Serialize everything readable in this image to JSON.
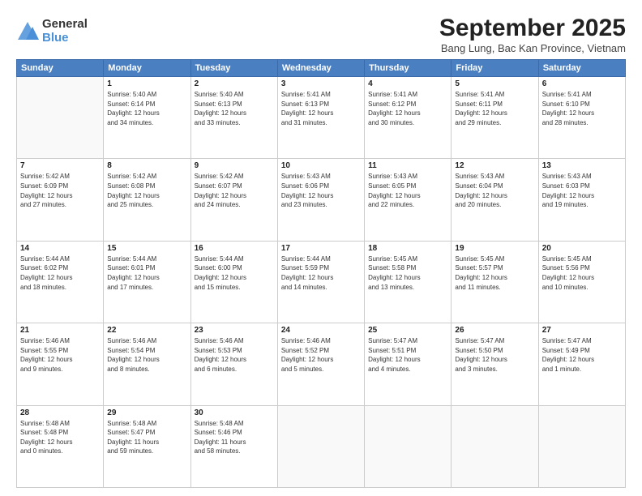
{
  "logo": {
    "general": "General",
    "blue": "Blue"
  },
  "title": "September 2025",
  "subtitle": "Bang Lung, Bac Kan Province, Vietnam",
  "headers": [
    "Sunday",
    "Monday",
    "Tuesday",
    "Wednesday",
    "Thursday",
    "Friday",
    "Saturday"
  ],
  "weeks": [
    [
      {
        "day": "",
        "info": ""
      },
      {
        "day": "1",
        "info": "Sunrise: 5:40 AM\nSunset: 6:14 PM\nDaylight: 12 hours\nand 34 minutes."
      },
      {
        "day": "2",
        "info": "Sunrise: 5:40 AM\nSunset: 6:13 PM\nDaylight: 12 hours\nand 33 minutes."
      },
      {
        "day": "3",
        "info": "Sunrise: 5:41 AM\nSunset: 6:13 PM\nDaylight: 12 hours\nand 31 minutes."
      },
      {
        "day": "4",
        "info": "Sunrise: 5:41 AM\nSunset: 6:12 PM\nDaylight: 12 hours\nand 30 minutes."
      },
      {
        "day": "5",
        "info": "Sunrise: 5:41 AM\nSunset: 6:11 PM\nDaylight: 12 hours\nand 29 minutes."
      },
      {
        "day": "6",
        "info": "Sunrise: 5:41 AM\nSunset: 6:10 PM\nDaylight: 12 hours\nand 28 minutes."
      }
    ],
    [
      {
        "day": "7",
        "info": "Sunrise: 5:42 AM\nSunset: 6:09 PM\nDaylight: 12 hours\nand 27 minutes."
      },
      {
        "day": "8",
        "info": "Sunrise: 5:42 AM\nSunset: 6:08 PM\nDaylight: 12 hours\nand 25 minutes."
      },
      {
        "day": "9",
        "info": "Sunrise: 5:42 AM\nSunset: 6:07 PM\nDaylight: 12 hours\nand 24 minutes."
      },
      {
        "day": "10",
        "info": "Sunrise: 5:43 AM\nSunset: 6:06 PM\nDaylight: 12 hours\nand 23 minutes."
      },
      {
        "day": "11",
        "info": "Sunrise: 5:43 AM\nSunset: 6:05 PM\nDaylight: 12 hours\nand 22 minutes."
      },
      {
        "day": "12",
        "info": "Sunrise: 5:43 AM\nSunset: 6:04 PM\nDaylight: 12 hours\nand 20 minutes."
      },
      {
        "day": "13",
        "info": "Sunrise: 5:43 AM\nSunset: 6:03 PM\nDaylight: 12 hours\nand 19 minutes."
      }
    ],
    [
      {
        "day": "14",
        "info": "Sunrise: 5:44 AM\nSunset: 6:02 PM\nDaylight: 12 hours\nand 18 minutes."
      },
      {
        "day": "15",
        "info": "Sunrise: 5:44 AM\nSunset: 6:01 PM\nDaylight: 12 hours\nand 17 minutes."
      },
      {
        "day": "16",
        "info": "Sunrise: 5:44 AM\nSunset: 6:00 PM\nDaylight: 12 hours\nand 15 minutes."
      },
      {
        "day": "17",
        "info": "Sunrise: 5:44 AM\nSunset: 5:59 PM\nDaylight: 12 hours\nand 14 minutes."
      },
      {
        "day": "18",
        "info": "Sunrise: 5:45 AM\nSunset: 5:58 PM\nDaylight: 12 hours\nand 13 minutes."
      },
      {
        "day": "19",
        "info": "Sunrise: 5:45 AM\nSunset: 5:57 PM\nDaylight: 12 hours\nand 11 minutes."
      },
      {
        "day": "20",
        "info": "Sunrise: 5:45 AM\nSunset: 5:56 PM\nDaylight: 12 hours\nand 10 minutes."
      }
    ],
    [
      {
        "day": "21",
        "info": "Sunrise: 5:46 AM\nSunset: 5:55 PM\nDaylight: 12 hours\nand 9 minutes."
      },
      {
        "day": "22",
        "info": "Sunrise: 5:46 AM\nSunset: 5:54 PM\nDaylight: 12 hours\nand 8 minutes."
      },
      {
        "day": "23",
        "info": "Sunrise: 5:46 AM\nSunset: 5:53 PM\nDaylight: 12 hours\nand 6 minutes."
      },
      {
        "day": "24",
        "info": "Sunrise: 5:46 AM\nSunset: 5:52 PM\nDaylight: 12 hours\nand 5 minutes."
      },
      {
        "day": "25",
        "info": "Sunrise: 5:47 AM\nSunset: 5:51 PM\nDaylight: 12 hours\nand 4 minutes."
      },
      {
        "day": "26",
        "info": "Sunrise: 5:47 AM\nSunset: 5:50 PM\nDaylight: 12 hours\nand 3 minutes."
      },
      {
        "day": "27",
        "info": "Sunrise: 5:47 AM\nSunset: 5:49 PM\nDaylight: 12 hours\nand 1 minute."
      }
    ],
    [
      {
        "day": "28",
        "info": "Sunrise: 5:48 AM\nSunset: 5:48 PM\nDaylight: 12 hours\nand 0 minutes."
      },
      {
        "day": "29",
        "info": "Sunrise: 5:48 AM\nSunset: 5:47 PM\nDaylight: 11 hours\nand 59 minutes."
      },
      {
        "day": "30",
        "info": "Sunrise: 5:48 AM\nSunset: 5:46 PM\nDaylight: 11 hours\nand 58 minutes."
      },
      {
        "day": "",
        "info": ""
      },
      {
        "day": "",
        "info": ""
      },
      {
        "day": "",
        "info": ""
      },
      {
        "day": "",
        "info": ""
      }
    ]
  ]
}
